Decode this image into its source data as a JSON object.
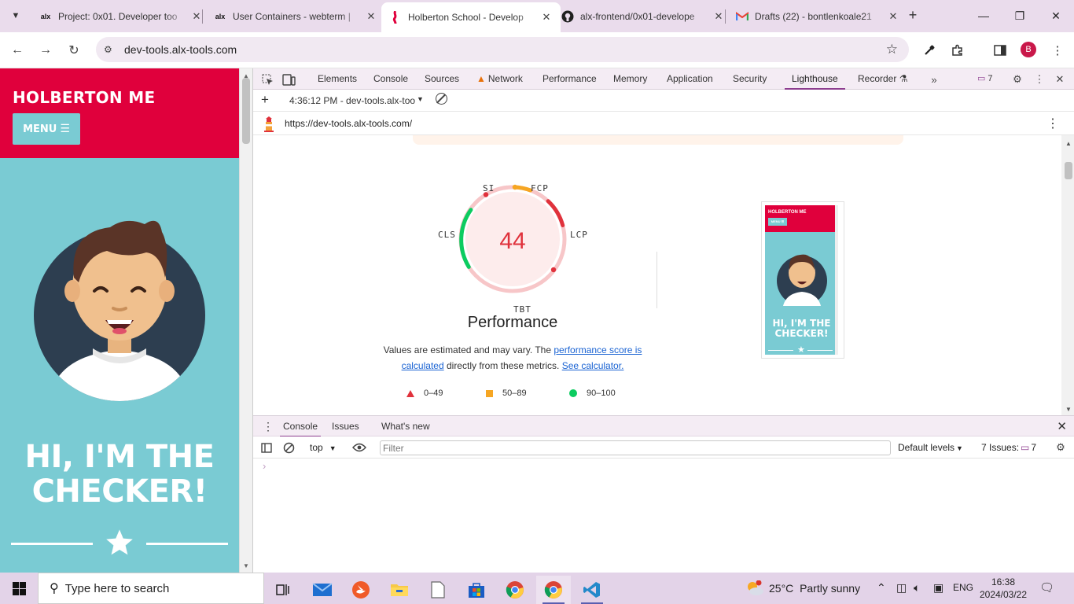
{
  "browser": {
    "tabs": [
      {
        "label": "Project: 0x01. Developer too",
        "favicon": "alx",
        "active": false
      },
      {
        "label": "User Containers - webterm |",
        "favicon": "alx",
        "active": false
      },
      {
        "label": "Holberton School - Develop",
        "favicon": "holberton",
        "active": true
      },
      {
        "label": "alx-frontend/0x01-develope",
        "favicon": "github",
        "active": false
      },
      {
        "label": "Drafts (22) - bontlenkoale21",
        "favicon": "gmail",
        "active": false
      }
    ],
    "url": "dev-tools.alx-tools.com",
    "profile_initial": "B"
  },
  "page": {
    "brand": "HOLBERTON ME",
    "menu_label": "MENU",
    "hero_line1": "HI, I'M THE",
    "hero_line2": "CHECKER!"
  },
  "devtools": {
    "tabs": [
      "Elements",
      "Console",
      "Sources",
      "Network",
      "Performance",
      "Memory",
      "Application",
      "Security",
      "Lighthouse",
      "Recorder"
    ],
    "active_tab": "Lighthouse",
    "issues_badge": "7",
    "lighthouse": {
      "report_label": "4:36:12 PM - dev-tools.alx-too",
      "audited_url": "https://dev-tools.alx-tools.com/",
      "score": "44",
      "category": "Performance",
      "metric_labels": {
        "si": "SI",
        "fcp": "FCP",
        "lcp": "LCP",
        "tbt": "TBT",
        "cls": "CLS"
      },
      "desc_prefix": "Values are estimated and may vary. The ",
      "desc_link1": "performance score is calculated",
      "desc_mid": " directly from these metrics. ",
      "desc_link2": "See calculator.",
      "legend": [
        {
          "label": "0–49",
          "color": "#e0323c"
        },
        {
          "label": "50–89",
          "color": "#f6a623"
        },
        {
          "label": "90–100",
          "color": "#0ccc60"
        }
      ],
      "thumbnail": {
        "brand": "HOLBERTON ME",
        "menu": "MENU ☰",
        "hero": "HI, I'M THE CHECKER!"
      }
    },
    "drawer": {
      "tabs": [
        "Console",
        "Issues",
        "What's new"
      ],
      "active": "Console",
      "context": "top",
      "filter_placeholder": "Filter",
      "levels": "Default levels",
      "issues_label": "7 Issues:",
      "issues_count": "7"
    }
  },
  "taskbar": {
    "search_placeholder": "Type here to search",
    "weather_temp": "25°C",
    "weather_text": "Partly sunny",
    "language": "ENG",
    "time": "16:38",
    "date": "2024/03/22"
  }
}
